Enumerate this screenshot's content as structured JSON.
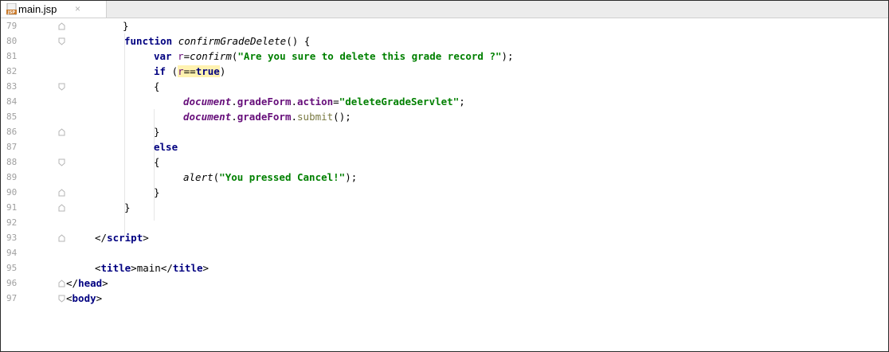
{
  "tab": {
    "filename": "main.jsp",
    "close": "×"
  },
  "lines": [
    {
      "n": "79"
    },
    {
      "n": "80"
    },
    {
      "n": "81"
    },
    {
      "n": "82"
    },
    {
      "n": "83"
    },
    {
      "n": "84"
    },
    {
      "n": "85"
    },
    {
      "n": "86"
    },
    {
      "n": "87"
    },
    {
      "n": "88"
    },
    {
      "n": "89"
    },
    {
      "n": "90"
    },
    {
      "n": "91"
    },
    {
      "n": "92"
    },
    {
      "n": "93"
    },
    {
      "n": "94"
    },
    {
      "n": "95"
    },
    {
      "n": "96"
    },
    {
      "n": "97"
    }
  ],
  "code": {
    "l79_brace": "}",
    "l80_kw": "function",
    "l80_name": "confirmGradeDelete",
    "l80_rest": "() {",
    "l81_kw": "var",
    "l81_var": "r",
    "l81_eq": "=",
    "l81_fn": "confirm",
    "l81_open": "(",
    "l81_str": "\"Are you sure to delete this grade record ?\"",
    "l81_close": ");",
    "l82_kw": "if",
    "l82_open": " (",
    "l82_var": "r",
    "l82_eq": "==",
    "l82_true": "true",
    "l82_close": ")",
    "l83_brace": "{",
    "l84_doc": "document",
    "l84_dot1": ".",
    "l84_form": "gradeForm",
    "l84_dot2": ".",
    "l84_action": "action",
    "l84_eq": "=",
    "l84_str": "\"deleteGradeServlet\"",
    "l84_semi": ";",
    "l85_doc": "document",
    "l85_dot1": ".",
    "l85_form": "gradeForm",
    "l85_dot2": ".",
    "l85_submit": "submit",
    "l85_rest": "();",
    "l86_brace": "}",
    "l87_kw": "else",
    "l88_brace": "{",
    "l89_fn": "alert",
    "l89_open": "(",
    "l89_str": "\"You pressed Cancel!\"",
    "l89_close": ");",
    "l90_brace": "}",
    "l91_brace": "}",
    "l93_open": "</",
    "l93_tag": "script",
    "l93_close": ">",
    "l95_open1": "<",
    "l95_tag1": "title",
    "l95_close1": ">",
    "l95_text": "main",
    "l95_open2": "</",
    "l95_tag2": "title",
    "l95_close2": ">",
    "l96_open": "</",
    "l96_tag": "head",
    "l96_close": ">",
    "l97_open": "<",
    "l97_tag": "body",
    "l97_close": ">"
  }
}
